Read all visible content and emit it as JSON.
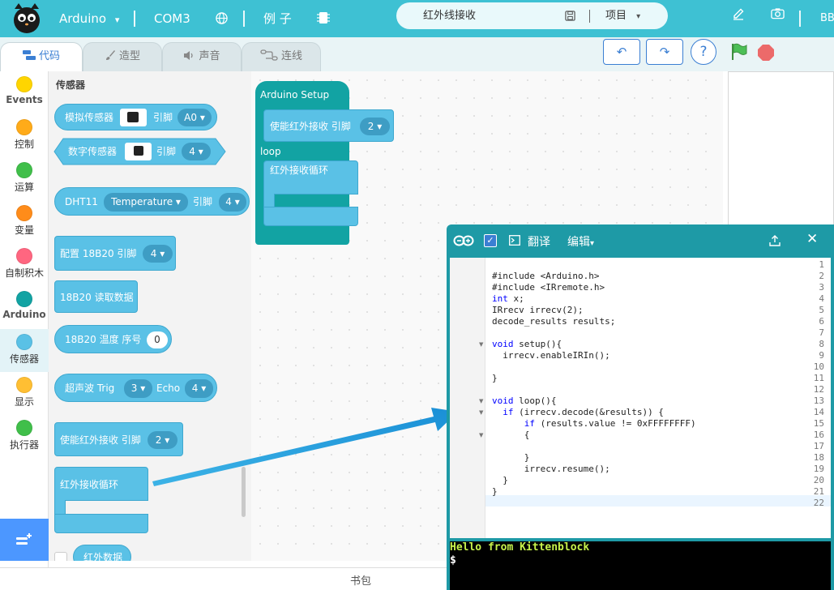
{
  "topbar": {
    "board": "Arduino",
    "port": "COM3",
    "examples": "例 子",
    "project_name": "红外线接收",
    "project_menu": "项目",
    "user_initials": "BB"
  },
  "tabs": [
    {
      "label": "代码"
    },
    {
      "label": "造型"
    },
    {
      "label": "声音"
    },
    {
      "label": "连线"
    }
  ],
  "categories": [
    {
      "label": "Events",
      "color": "#ffd500"
    },
    {
      "label": "控制",
      "color": "#ffab19"
    },
    {
      "label": "运算",
      "color": "#40bf4a"
    },
    {
      "label": "变量",
      "color": "#ff8c1a"
    },
    {
      "label": "自制积木",
      "color": "#ff6680"
    },
    {
      "label": "Arduino",
      "color": "#12a3a3"
    },
    {
      "label": "传感器",
      "color": "#5ac1e6"
    },
    {
      "label": "显示",
      "color": "#ffbf33"
    },
    {
      "label": "执行器",
      "color": "#40bf4a"
    }
  ],
  "palette": {
    "title": "传感器",
    "analog_label": "模拟传感器",
    "pin_label": "引脚",
    "analog_pin": "A0",
    "digital_label": "数字传感器",
    "digital_pin": "4",
    "dht_label": "DHT11",
    "dht_mode": "Temperature",
    "dht_pin": "4",
    "ds_config": "配置 18B20 引脚",
    "ds_config_pin": "4",
    "ds_read": "18B20 读取数据",
    "ds_temp": "18B20 温度 序号",
    "ds_index": "0",
    "ultra_label": "超声波 Trig",
    "trig_pin": "3",
    "echo_label": "Echo",
    "echo_pin": "4",
    "ir_enable": "使能红外接收 引脚",
    "ir_enable_pin": "2",
    "ir_loop": "红外接收循环",
    "ir_data": "红外数据"
  },
  "workspace": {
    "setup_label": "Arduino Setup",
    "ir_enable": "使能红外接收 引脚",
    "ir_enable_pin": "2",
    "loop_label": "loop",
    "ir_loop": "红外接收循环"
  },
  "codewin": {
    "translate": "翻译",
    "edit": "编辑",
    "lines": [
      "",
      "#include <Arduino.h>",
      "#include <IRremote.h>",
      "int x;",
      "IRrecv irrecv(2);",
      "decode_results results;",
      "",
      "void setup(){",
      "  irrecv.enableIRIn();",
      "",
      "}",
      "",
      "void loop(){",
      "  if (irrecv.decode(&results)) {",
      "      if (results.value != 0xFFFFFFFF)",
      "      {",
      "",
      "      }",
      "      irrecv.resume();",
      "  }",
      "}",
      ""
    ],
    "console_line1": "Hello from Kittenblock",
    "console_line2": "$"
  },
  "statusbar": {
    "backpack": "书包"
  }
}
